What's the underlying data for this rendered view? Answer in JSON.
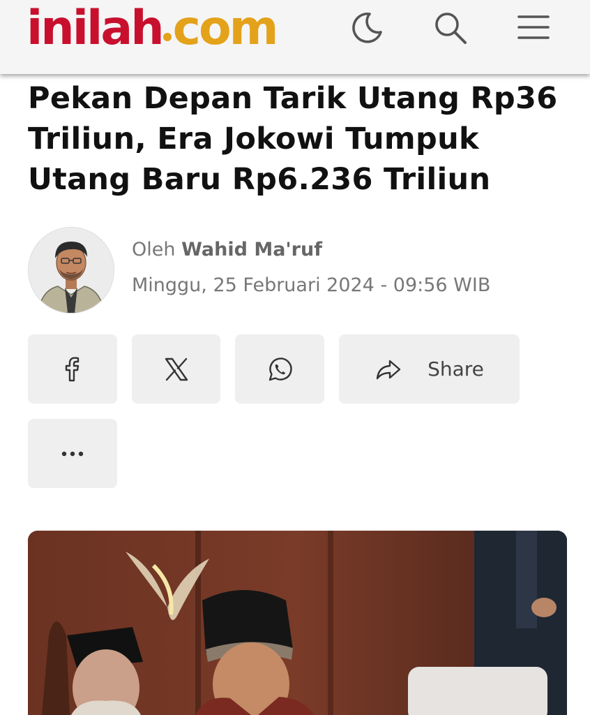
{
  "header": {
    "logo_main": "inilah",
    "logo_suffix": "com",
    "icons": [
      "moon-icon",
      "search-icon",
      "menu-icon"
    ]
  },
  "article": {
    "title": "Pekan Depan Tarik Utang Rp36 Triliun, Era Jokowi Tumpuk Utang Baru Rp6.236 Triliun",
    "byline_prefix": "Oleh",
    "author": "Wahid Ma'ruf",
    "date": "Minggu, 25 Februari 2024 - 09:56 WIB"
  },
  "share": {
    "buttons": [
      "facebook-icon",
      "x-icon",
      "whatsapp-icon",
      "share-icon",
      "more-icon"
    ],
    "share_label": "Share"
  },
  "colors": {
    "logo_red": "#c8102e",
    "logo_gold": "#e3a21a",
    "button_bg": "#efefef",
    "header_bg": "#f5f5f5"
  }
}
